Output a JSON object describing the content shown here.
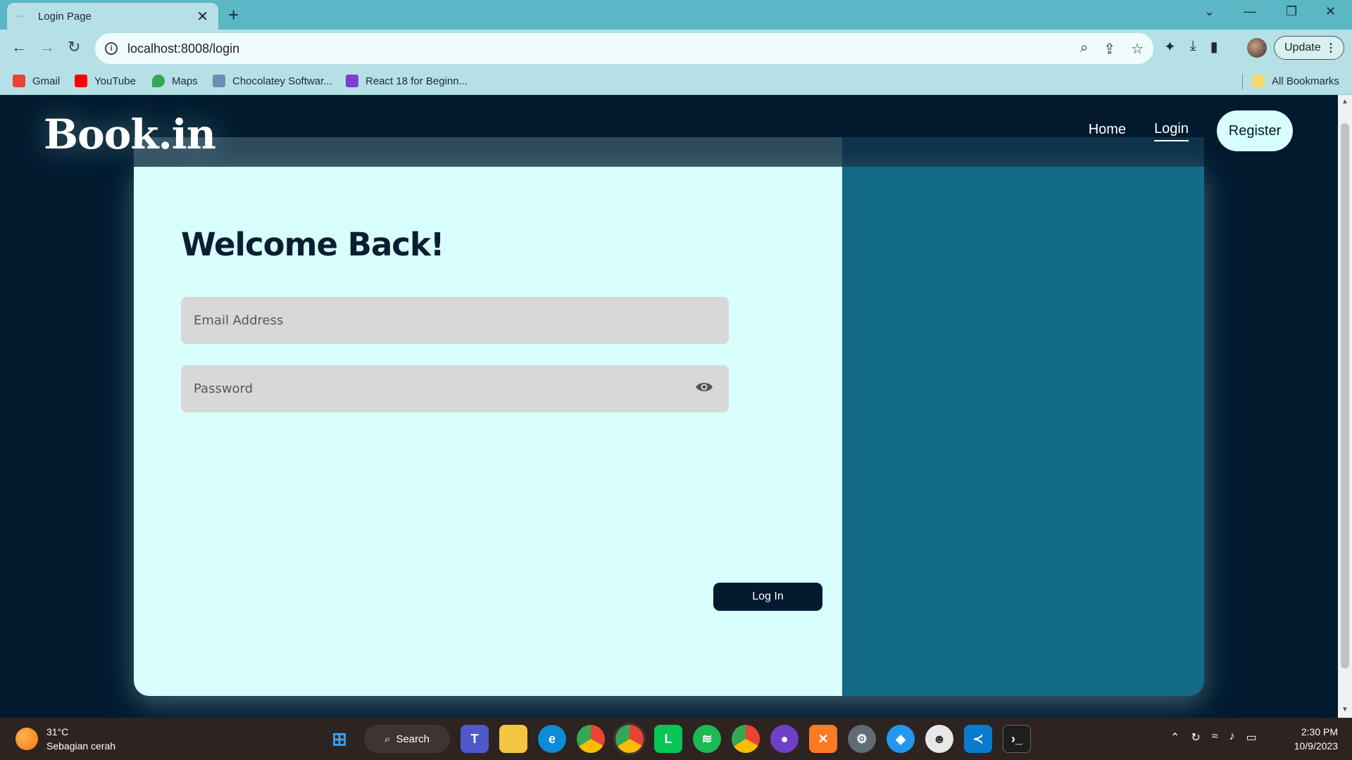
{
  "browser": {
    "tab_title": "Login Page",
    "url": "localhost:8008/login",
    "update_label": "Update",
    "bookmarks": [
      {
        "label": "Gmail",
        "color": "#ea4335"
      },
      {
        "label": "YouTube",
        "color": "#ff0000"
      },
      {
        "label": "Maps",
        "color": "#34a853"
      },
      {
        "label": "Chocolatey Softwar...",
        "color": "#6b8fb3"
      },
      {
        "label": "React 18 for Beginn...",
        "color": "#7a3fd1"
      }
    ],
    "all_bookmarks_label": "All Bookmarks"
  },
  "site": {
    "brand": "Book.in",
    "nav": {
      "home": "Home",
      "login": "Login",
      "register": "Register"
    }
  },
  "login": {
    "heading": "Welcome Back!",
    "email_placeholder": "Email Address",
    "password_placeholder": "Password",
    "submit_label": "Log In"
  },
  "taskbar": {
    "weather_temp": "31°C",
    "weather_desc": "Sebagian cerah",
    "search_label": "Search",
    "time": "2:30 PM",
    "date": "10/9/2023"
  },
  "colors": {
    "page_bg": "#021a2e",
    "card_left": "#d8fffb",
    "card_right": "#146b88",
    "button_dark": "#021a2e"
  }
}
